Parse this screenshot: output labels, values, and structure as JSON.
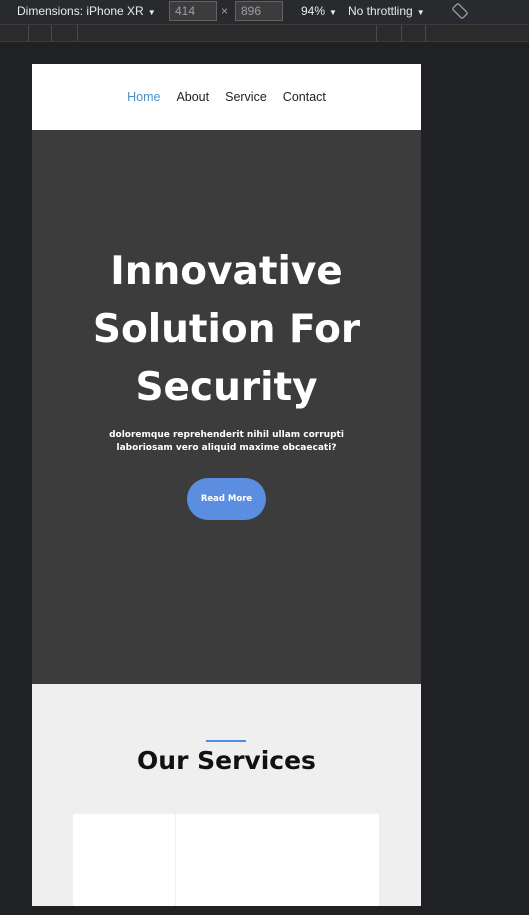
{
  "devtools": {
    "dimensions_label": "Dimensions: iPhone XR",
    "width_value": "414",
    "height_value": "896",
    "times": "×",
    "zoom": "94%",
    "throttling": "No throttling"
  },
  "nav": {
    "items": [
      {
        "label": "Home",
        "active": true
      },
      {
        "label": "About"
      },
      {
        "label": "Service"
      },
      {
        "label": "Contact"
      }
    ]
  },
  "hero": {
    "title": "Innovative Solution For Security",
    "subtitle": "doloremque reprehenderit nihil ullam corrupti laboriosam vero aliquid maxime obcaecati?",
    "button_label": "Read More"
  },
  "services": {
    "title": "Our Services"
  },
  "colors": {
    "accent": "#5b8ee0",
    "nav_active": "#4a90c8",
    "hero_bg": "#3c3c3c"
  }
}
